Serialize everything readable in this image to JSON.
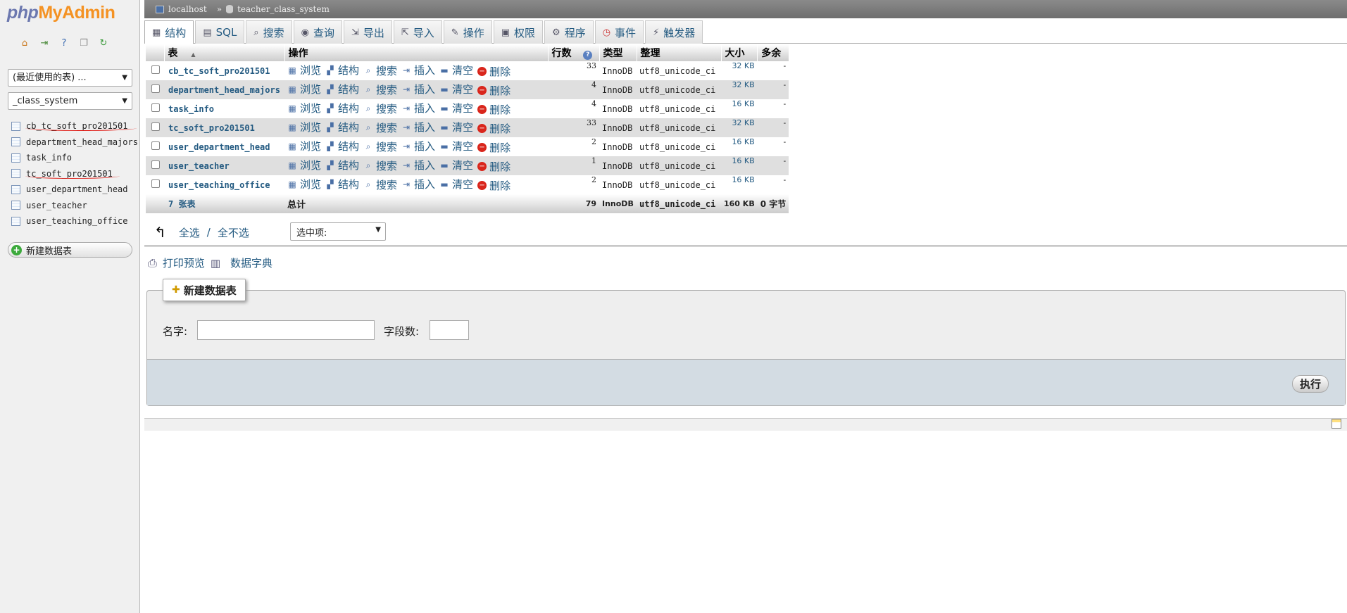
{
  "nav": {
    "logo": {
      "php": "php",
      "my": "My",
      "admin": "Admin"
    },
    "icons": [
      "home-icon",
      "logout-icon",
      "help-icon",
      "docs-icon",
      "reload-icon"
    ],
    "recent_select": "(最近使用的表) ...",
    "db_select": "_class_system",
    "tables": [
      "cb_tc_soft_pro201501",
      "department_head_majors",
      "task_info",
      "tc_soft_pro201501",
      "user_department_head",
      "user_teacher",
      "user_teaching_office"
    ],
    "new_table": "新建数据表"
  },
  "breadcrumb": {
    "server": "localhost",
    "separator": "»",
    "database": "teacher_class_system"
  },
  "tabs": [
    "结构",
    "SQL",
    "搜索",
    "查询",
    "导出",
    "导入",
    "操作",
    "权限",
    "程序",
    "事件",
    "触发器"
  ],
  "table": {
    "headers": {
      "table": "表",
      "sort": "▲",
      "action": "操作",
      "rows": "行数",
      "type": "类型",
      "collation": "整理",
      "size": "大小",
      "overhead": "多余"
    },
    "actions": [
      "浏览",
      "结构",
      "搜索",
      "插入",
      "清空",
      "删除"
    ],
    "rows": [
      {
        "name": "cb_tc_soft_pro201501",
        "rows": "33",
        "type": "InnoDB",
        "collation": "utf8_unicode_ci",
        "size": "32 KB",
        "overhead": "-"
      },
      {
        "name": "department_head_majors",
        "rows": "4",
        "type": "InnoDB",
        "collation": "utf8_unicode_ci",
        "size": "32 KB",
        "overhead": "-"
      },
      {
        "name": "task_info",
        "rows": "4",
        "type": "InnoDB",
        "collation": "utf8_unicode_ci",
        "size": "16 KB",
        "overhead": "-"
      },
      {
        "name": "tc_soft_pro201501",
        "rows": "33",
        "type": "InnoDB",
        "collation": "utf8_unicode_ci",
        "size": "32 KB",
        "overhead": "-"
      },
      {
        "name": "user_department_head",
        "rows": "2",
        "type": "InnoDB",
        "collation": "utf8_unicode_ci",
        "size": "16 KB",
        "overhead": "-"
      },
      {
        "name": "user_teacher",
        "rows": "1",
        "type": "InnoDB",
        "collation": "utf8_unicode_ci",
        "size": "16 KB",
        "overhead": "-"
      },
      {
        "name": "user_teaching_office",
        "rows": "2",
        "type": "InnoDB",
        "collation": "utf8_unicode_ci",
        "size": "16 KB",
        "overhead": "-"
      }
    ],
    "total": {
      "name": "7 张表",
      "label": "总计",
      "rows": "79",
      "type": "InnoDB",
      "collation": "utf8_unicode_ci",
      "size": "160 KB",
      "overhead": "0 字节"
    }
  },
  "bulk": {
    "check_all": "全选",
    "separator": "/",
    "uncheck_all": "全不选",
    "with_selected": "选中项:"
  },
  "links": {
    "print": "打印预览",
    "dictionary": "数据字典"
  },
  "create": {
    "legend": "新建数据表",
    "name_label": "名字:",
    "fields_label": "字段数:",
    "go": "执行"
  }
}
